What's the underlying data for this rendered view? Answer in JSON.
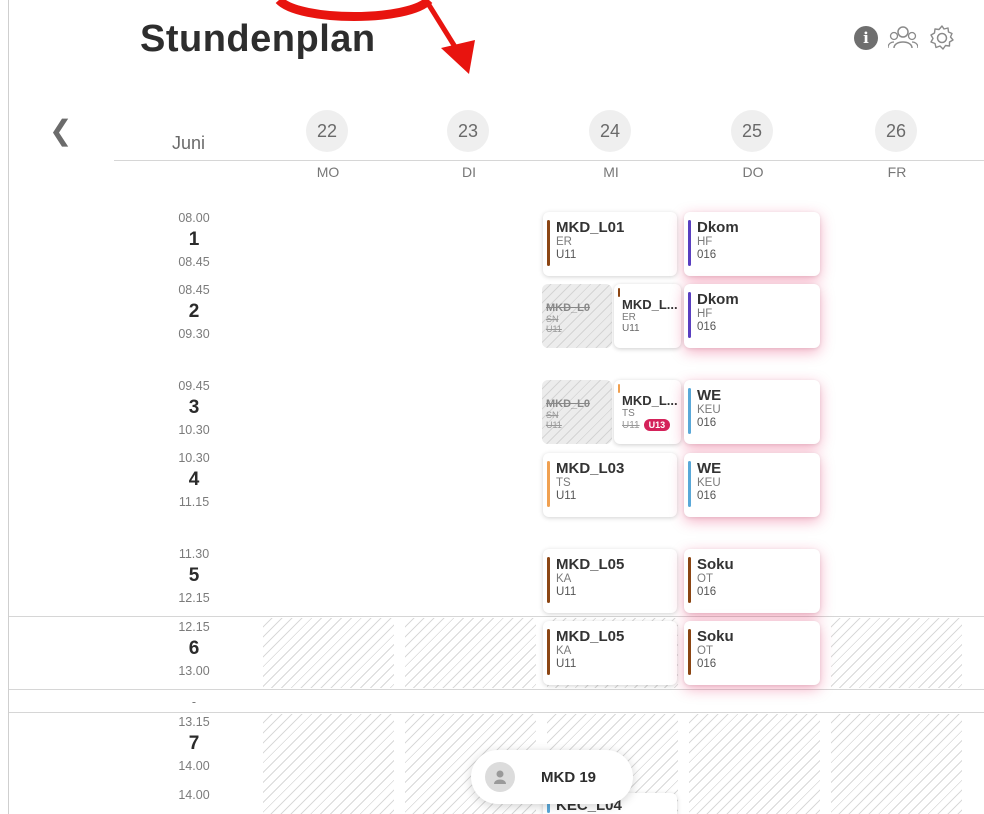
{
  "header": {
    "title": "Stundenplan",
    "icons": [
      "info-icon",
      "users-icon",
      "settings-icon"
    ]
  },
  "calendar": {
    "month": "Juni",
    "days": [
      {
        "date": "22",
        "name": "MO"
      },
      {
        "date": "23",
        "name": "DI"
      },
      {
        "date": "24",
        "name": "MI"
      },
      {
        "date": "25",
        "name": "DO"
      },
      {
        "date": "26",
        "name": "FR"
      }
    ],
    "periods": [
      {
        "start": "08.00",
        "num": "1",
        "end": "08.45"
      },
      {
        "start": "08.45",
        "num": "2",
        "end": "09.30"
      },
      {
        "start": "09.45",
        "num": "3",
        "end": "10.30"
      },
      {
        "start": "10.30",
        "num": "4",
        "end": "11.15"
      },
      {
        "start": "11.30",
        "num": "5",
        "end": "12.15"
      },
      {
        "start": "12.15",
        "num": "6",
        "end": "13.00"
      },
      {
        "start": "-",
        "num": "",
        "end": ""
      },
      {
        "start": "13.15",
        "num": "7",
        "end": "14.00"
      },
      {
        "start": "14.00",
        "num": "",
        "end": ""
      }
    ]
  },
  "lessons": {
    "mi1": {
      "subject": "MKD_L01",
      "teacher": "ER",
      "room": "U11",
      "color": "#8b4513"
    },
    "mi2_cancel": {
      "subject": "MKD_L0",
      "teacher": "SN",
      "room": "U11"
    },
    "mi2": {
      "subject": "MKD_L...",
      "teacher": "ER",
      "room": "U11",
      "color": "#8b4513"
    },
    "mi3_cancel": {
      "subject": "MKD_L0",
      "teacher": "SN",
      "room": "U11"
    },
    "mi3": {
      "subject": "MKD_L...",
      "teacher": "TS",
      "room_old": "U11",
      "room_new": "U13",
      "color": "#f0a050"
    },
    "mi4": {
      "subject": "MKD_L03",
      "teacher": "TS",
      "room": "U11",
      "color": "#f0a050"
    },
    "mi5": {
      "subject": "MKD_L05",
      "teacher": "KA",
      "room": "U11",
      "color": "#8b4513"
    },
    "mi6": {
      "subject": "MKD_L05",
      "teacher": "KA",
      "room": "U11",
      "color": "#8b4513"
    },
    "mi8": {
      "subject": "KEC_L04"
    },
    "do1": {
      "subject": "Dkom",
      "teacher": "HF",
      "room": "016",
      "color": "#5a3fc0"
    },
    "do2": {
      "subject": "Dkom",
      "teacher": "HF",
      "room": "016",
      "color": "#5a3fc0"
    },
    "do3": {
      "subject": "WE",
      "teacher": "KEU",
      "room": "016",
      "color": "#5aa8d8"
    },
    "do4": {
      "subject": "WE",
      "teacher": "KEU",
      "room": "016",
      "color": "#5aa8d8"
    },
    "do5": {
      "subject": "Soku",
      "teacher": "OT",
      "room": "016",
      "color": "#8b4513"
    },
    "do6": {
      "subject": "Soku",
      "teacher": "OT",
      "room": "016",
      "color": "#8b4513"
    }
  },
  "user": {
    "name": "MKD 19"
  },
  "colors": {
    "highlight_shadow": "#e0205a",
    "annotation_red": "#e8140f"
  }
}
